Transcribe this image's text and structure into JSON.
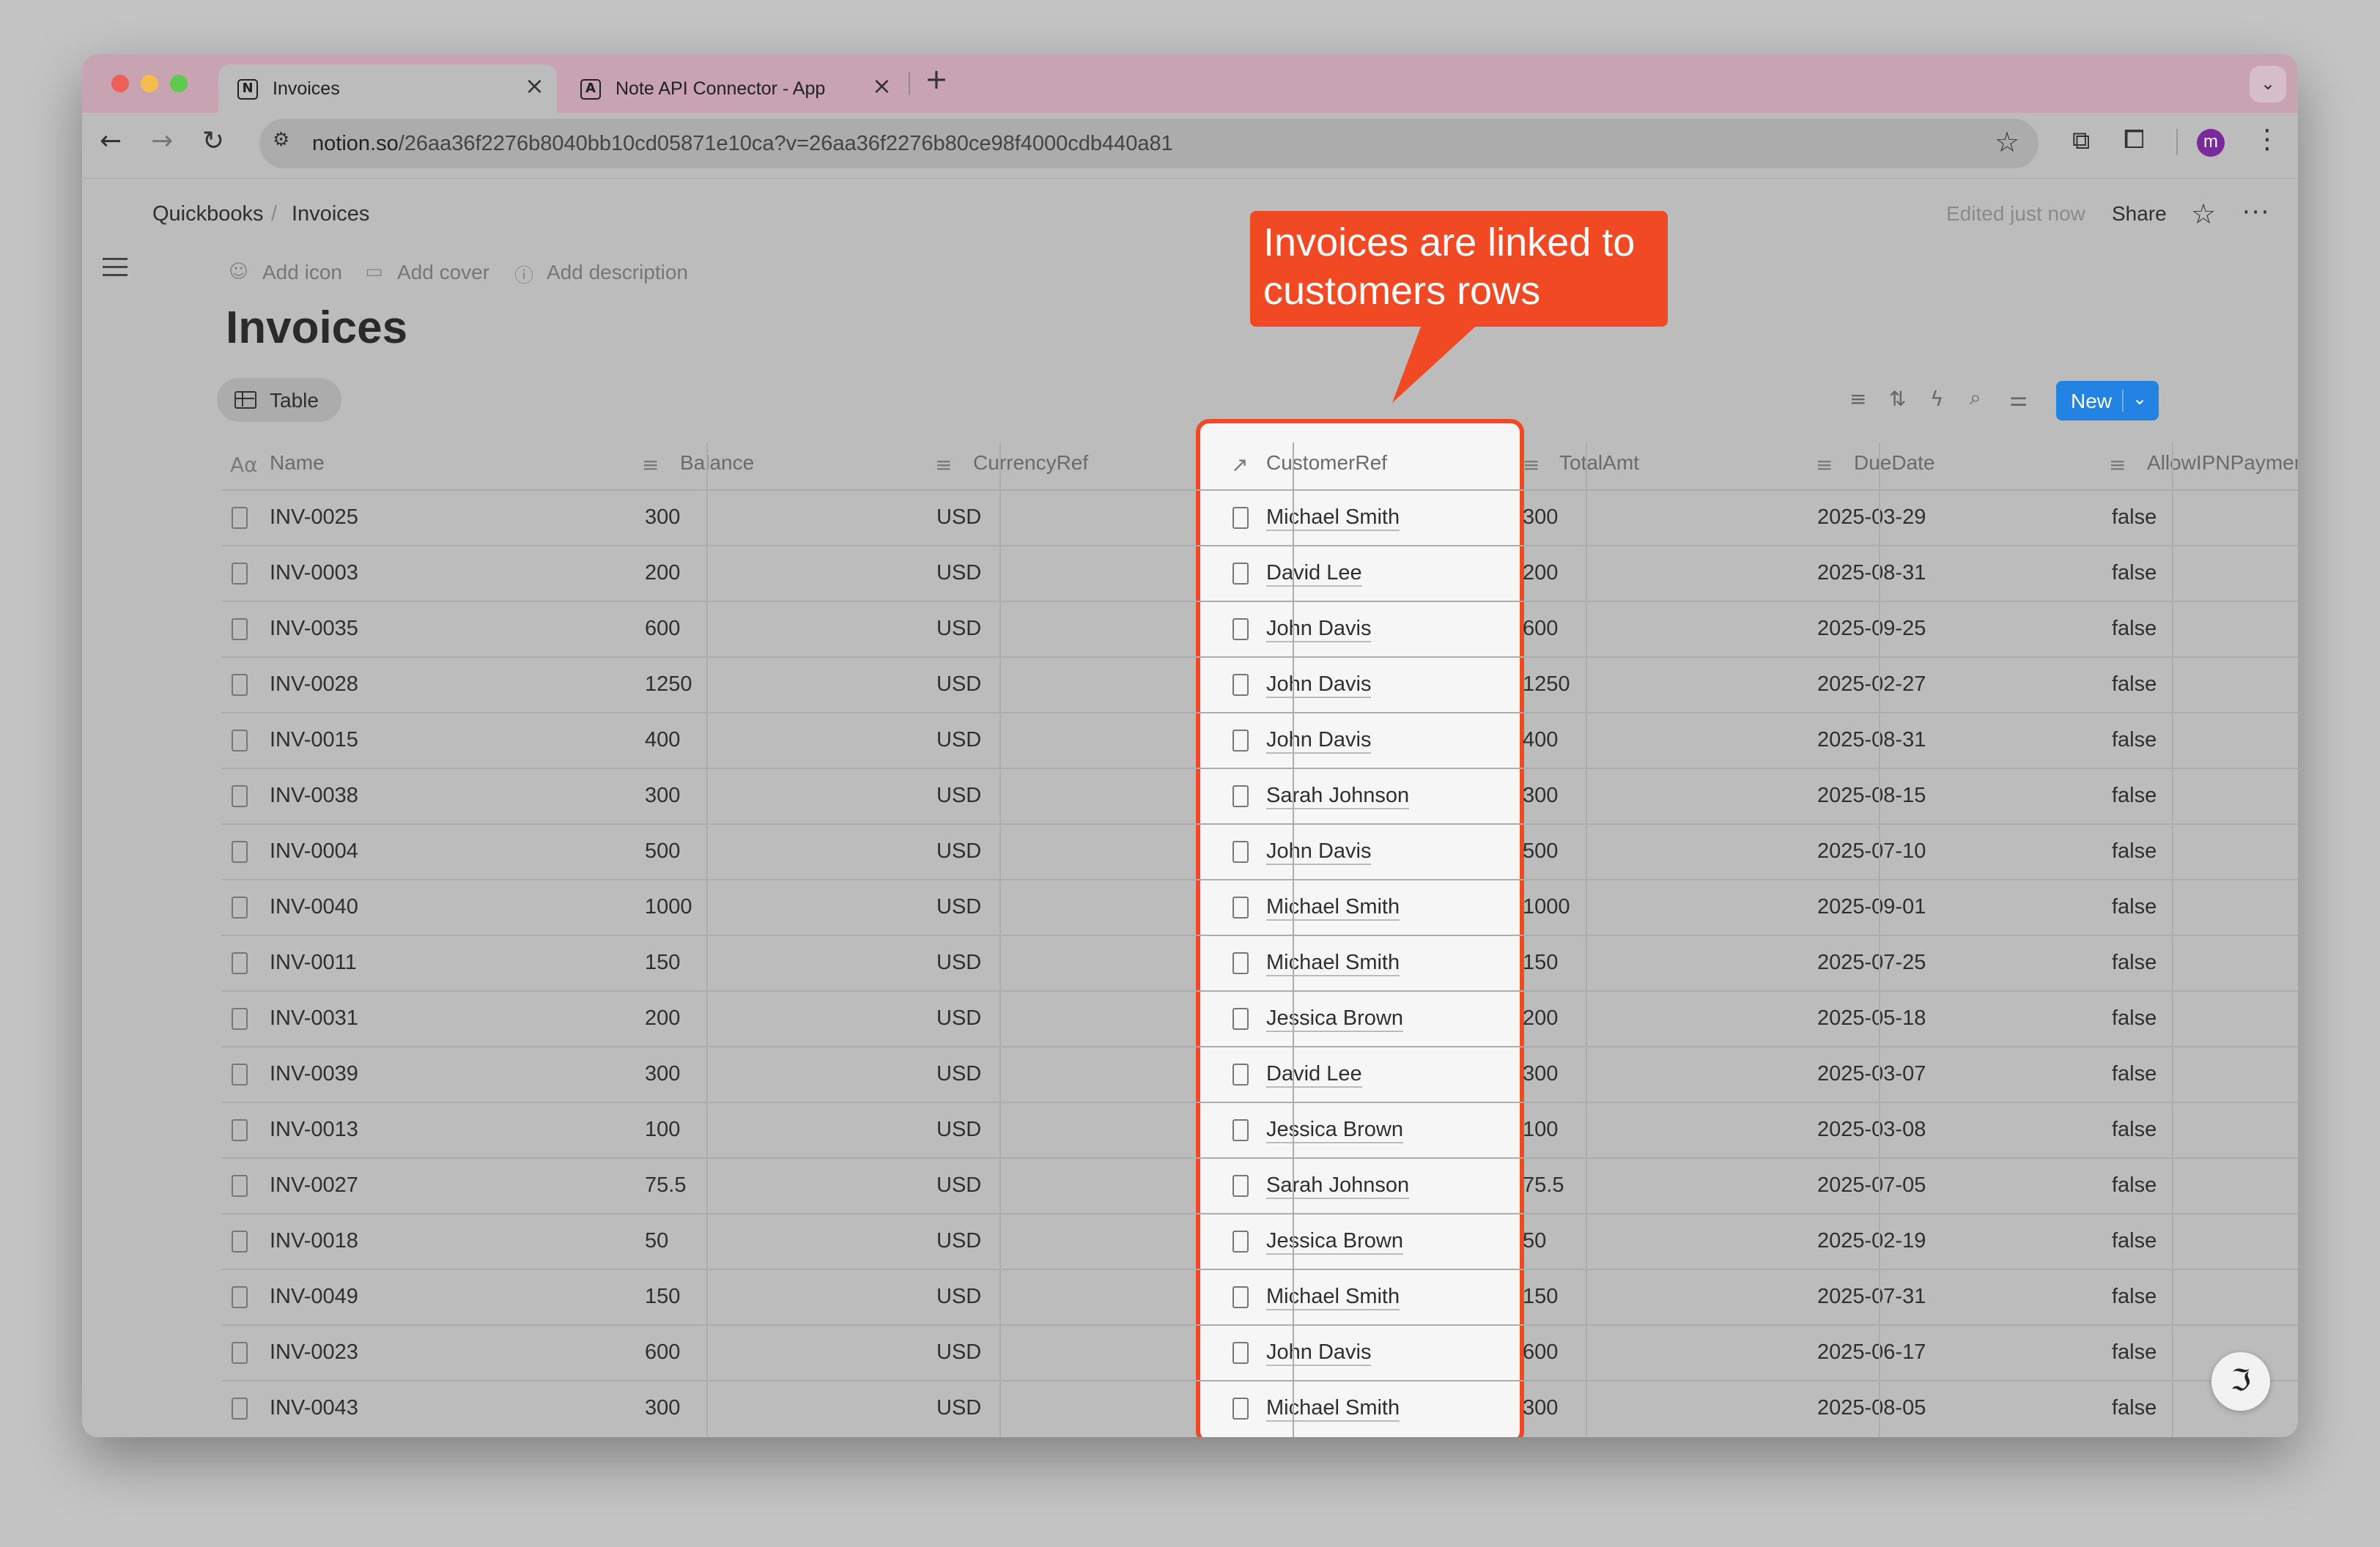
{
  "browser": {
    "tabs": [
      {
        "label": "Invoices",
        "icon": "N"
      },
      {
        "label": "Note API Connector - App",
        "icon": "A"
      }
    ],
    "new_tab": "+",
    "url_domain": "notion.so",
    "url_path": "/26aa36f2276b8040bb10cd05871e10ca?v=26aa36f2276b80ce98f4000cdb440a81",
    "profile_initial": "m"
  },
  "breadcrumb": {
    "parent": "Quickbooks",
    "separator": "/",
    "current": "Invoices"
  },
  "topbar": {
    "edited": "Edited just now",
    "share": "Share"
  },
  "page_actions": {
    "add_icon": "Add icon",
    "add_cover": "Add cover",
    "add_description": "Add description"
  },
  "title": "Invoices",
  "view_tab": "Table",
  "new_button": "New",
  "columns": {
    "name": "Name",
    "balance": "Balance",
    "currency": "CurrencyRef",
    "customer": "CustomerRef",
    "total": "TotalAmt",
    "due": "DueDate",
    "allow": "AllowIPNPaymer"
  },
  "rows": [
    {
      "name": "INV-0025",
      "balance": "300",
      "currency": "USD",
      "customer": "Michael Smith",
      "total": "300",
      "due": "2025-03-29",
      "allow": "false"
    },
    {
      "name": "INV-0003",
      "balance": "200",
      "currency": "USD",
      "customer": "David Lee",
      "total": "200",
      "due": "2025-08-31",
      "allow": "false"
    },
    {
      "name": "INV-0035",
      "balance": "600",
      "currency": "USD",
      "customer": "John Davis",
      "total": "600",
      "due": "2025-09-25",
      "allow": "false"
    },
    {
      "name": "INV-0028",
      "balance": "1250",
      "currency": "USD",
      "customer": "John Davis",
      "total": "1250",
      "due": "2025-02-27",
      "allow": "false"
    },
    {
      "name": "INV-0015",
      "balance": "400",
      "currency": "USD",
      "customer": "John Davis",
      "total": "400",
      "due": "2025-08-31",
      "allow": "false"
    },
    {
      "name": "INV-0038",
      "balance": "300",
      "currency": "USD",
      "customer": "Sarah Johnson",
      "total": "300",
      "due": "2025-08-15",
      "allow": "false"
    },
    {
      "name": "INV-0004",
      "balance": "500",
      "currency": "USD",
      "customer": "John Davis",
      "total": "500",
      "due": "2025-07-10",
      "allow": "false"
    },
    {
      "name": "INV-0040",
      "balance": "1000",
      "currency": "USD",
      "customer": "Michael Smith",
      "total": "1000",
      "due": "2025-09-01",
      "allow": "false"
    },
    {
      "name": "INV-0011",
      "balance": "150",
      "currency": "USD",
      "customer": "Michael Smith",
      "total": "150",
      "due": "2025-07-25",
      "allow": "false"
    },
    {
      "name": "INV-0031",
      "balance": "200",
      "currency": "USD",
      "customer": "Jessica Brown",
      "total": "200",
      "due": "2025-05-18",
      "allow": "false"
    },
    {
      "name": "INV-0039",
      "balance": "300",
      "currency": "USD",
      "customer": "David Lee",
      "total": "300",
      "due": "2025-03-07",
      "allow": "false"
    },
    {
      "name": "INV-0013",
      "balance": "100",
      "currency": "USD",
      "customer": "Jessica Brown",
      "total": "100",
      "due": "2025-03-08",
      "allow": "false"
    },
    {
      "name": "INV-0027",
      "balance": "75.5",
      "currency": "USD",
      "customer": "Sarah Johnson",
      "total": "75.5",
      "due": "2025-07-05",
      "allow": "false"
    },
    {
      "name": "INV-0018",
      "balance": "50",
      "currency": "USD",
      "customer": "Jessica Brown",
      "total": "50",
      "due": "2025-02-19",
      "allow": "false"
    },
    {
      "name": "INV-0049",
      "balance": "150",
      "currency": "USD",
      "customer": "Michael Smith",
      "total": "150",
      "due": "2025-07-31",
      "allow": "false"
    },
    {
      "name": "INV-0023",
      "balance": "600",
      "currency": "USD",
      "customer": "John Davis",
      "total": "600",
      "due": "2025-06-17",
      "allow": "false"
    },
    {
      "name": "INV-0043",
      "balance": "300",
      "currency": "USD",
      "customer": "Michael Smith",
      "total": "300",
      "due": "2025-08-05",
      "allow": "false"
    }
  ],
  "callout": {
    "line1": "Invoices are linked to",
    "line2": "customers rows"
  },
  "colors": {
    "accent": "#f04923",
    "new_button": "#2383e2",
    "tabbar": "#c8a3b2"
  }
}
